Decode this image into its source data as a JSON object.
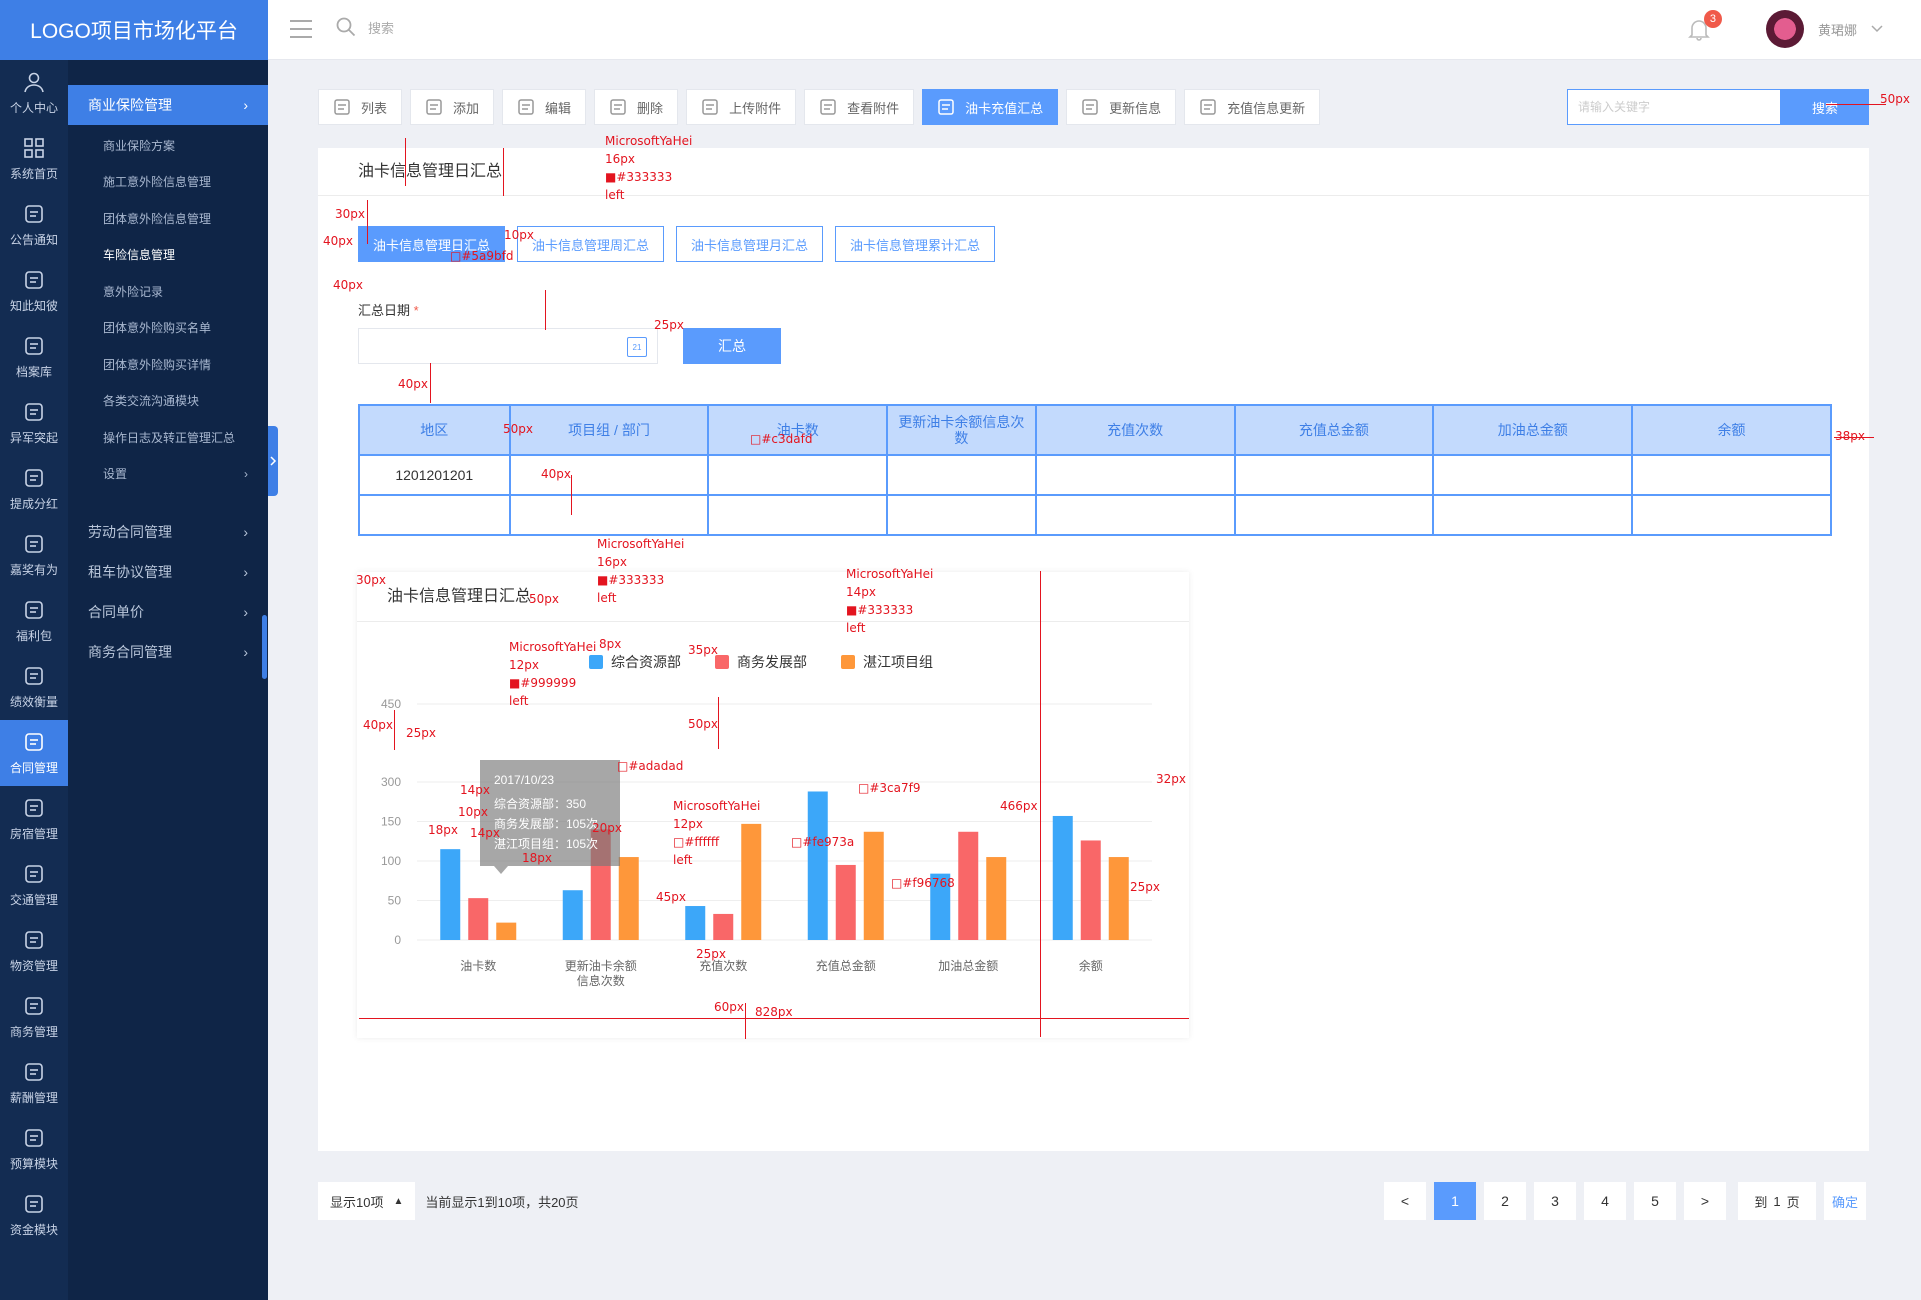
{
  "app": {
    "title": "LOGO项目市场化平台"
  },
  "topbar": {
    "search_placeholder": "搜索",
    "notification_count": "3",
    "username": "黄珺娜"
  },
  "rail": [
    {
      "label": "个人中心",
      "icon": "user-icon"
    },
    {
      "label": "系统首页",
      "icon": "grid-icon"
    },
    {
      "label": "公告通知",
      "icon": "bell-icon"
    },
    {
      "label": "知此知彼",
      "icon": "graduation-cap-icon"
    },
    {
      "label": "档案库",
      "icon": "monitor-chart-icon"
    },
    {
      "label": "异军突起",
      "icon": "megaphone-icon"
    },
    {
      "label": "提成分红",
      "icon": "dollar-icon"
    },
    {
      "label": "嘉奖有为",
      "icon": "trophy-icon"
    },
    {
      "label": "福利包",
      "icon": "gift-icon"
    },
    {
      "label": "绩效衡量",
      "icon": "user-search-icon"
    },
    {
      "label": "合同管理",
      "icon": "contract-icon",
      "active": true
    },
    {
      "label": "房宿管理",
      "icon": "house-icon"
    },
    {
      "label": "交通管理",
      "icon": "bus-icon"
    },
    {
      "label": "物资管理",
      "icon": "lotus-icon"
    },
    {
      "label": "商务管理",
      "icon": "briefcase-icon"
    },
    {
      "label": "薪酬管理",
      "icon": "wallet-icon"
    },
    {
      "label": "预算模块",
      "icon": "sliders-icon"
    },
    {
      "label": "资金模块",
      "icon": "coins-icon"
    }
  ],
  "sidebar": {
    "section": "商业保险管理",
    "items": [
      "商业保险方案",
      "施工意外险信息管理",
      "团体意外险信息管理",
      "车险信息管理",
      "意外险记录",
      "团体意外险购买名单",
      "团体意外险购买详情",
      "各类交流沟通模块",
      "操作日志及转正管理汇总",
      "设置"
    ],
    "active_index": 3,
    "groups": [
      "劳动合同管理",
      "租车协议管理",
      "合同单价",
      "商务合同管理"
    ]
  },
  "toolbar": {
    "buttons": [
      {
        "label": "列表",
        "icon": "list-icon"
      },
      {
        "label": "添加",
        "icon": "plus-circle-icon"
      },
      {
        "label": "编辑",
        "icon": "edit-icon"
      },
      {
        "label": "删除",
        "icon": "trash-icon"
      },
      {
        "label": "上传附件",
        "icon": "paperclip-icon"
      },
      {
        "label": "查看附件",
        "icon": "magnifier-icon"
      },
      {
        "label": "油卡充值汇总",
        "icon": "clipboard-icon",
        "active": true
      },
      {
        "label": "更新信息",
        "icon": "chat-icon"
      },
      {
        "label": "充值信息更新",
        "icon": "chat-dots-icon"
      }
    ],
    "keyword_placeholder": "请输入关键字",
    "search_label": "搜索"
  },
  "panel": {
    "title": "油卡信息管理日汇总",
    "tabs": [
      "油卡信息管理日汇总",
      "油卡信息管理周汇总",
      "油卡信息管理月汇总",
      "油卡信息管理累计汇总"
    ],
    "active_tab": 0,
    "date_label": "汇总日期",
    "required_mark": "*",
    "date_icon_text": "21",
    "submit_label": "汇总"
  },
  "table": {
    "headers": [
      "地区",
      "项目组 / 部门",
      "油卡数",
      "更新油卡余额信息次数",
      "充值次数",
      "充值总金额",
      "加油总金额",
      "余额"
    ],
    "rows": [
      [
        "1201201201",
        "",
        "",
        "",
        "",
        "",
        "",
        ""
      ],
      [
        "",
        "",
        "",
        "",
        "",
        "",
        "",
        ""
      ]
    ]
  },
  "chart_card": {
    "title": "油卡信息管理日汇总"
  },
  "chart_data": {
    "type": "bar",
    "categories": [
      "油卡数",
      "更新油卡余额\n信息次数",
      "充值次数",
      "充值总金额",
      "加油总金额",
      "余额"
    ],
    "series": [
      {
        "name": "综合资源部",
        "color": "#3ca7f9",
        "values": [
          115,
          63,
          43,
          188,
          84,
          157
        ]
      },
      {
        "name": "商务发展部",
        "color": "#f96768",
        "values": [
          53,
          140,
          33,
          95,
          137,
          126
        ]
      },
      {
        "name": "湛江项目组",
        "color": "#fe973a",
        "values": [
          22,
          105,
          147,
          137,
          105,
          105
        ]
      }
    ],
    "y_ticks": [
      0,
      50,
      100,
      150,
      200,
      450
    ],
    "y_tick_labels": [
      "0",
      "50",
      "100",
      "150",
      "300",
      "450"
    ],
    "ylim": [
      0,
      250
    ],
    "grid": true,
    "legend": "top-center",
    "tooltip": {
      "date": "2017/10/23",
      "lines": [
        "综合资源部：350",
        "商务发展部：105次",
        "湛江项目组：105次"
      ]
    }
  },
  "annotations": [
    {
      "id": "a1",
      "text": "MicrosoftYaHei\n16px\n■#333333\nleft"
    },
    {
      "id": "a2",
      "text": "30px"
    },
    {
      "id": "a3",
      "text": "40px"
    },
    {
      "id": "a4",
      "text": "10px"
    },
    {
      "id": "a5",
      "text": "□#5a9bfd"
    },
    {
      "id": "a6",
      "text": "40px"
    },
    {
      "id": "a7",
      "text": "25px"
    },
    {
      "id": "a8",
      "text": "40px"
    },
    {
      "id": "a9",
      "text": "50px"
    },
    {
      "id": "a10",
      "text": "□#c3dafd"
    },
    {
      "id": "a11",
      "text": "40px"
    },
    {
      "id": "a12",
      "text": "38px"
    },
    {
      "id": "a13",
      "text": "50px"
    },
    {
      "id": "a14",
      "text": "MicrosoftYaHei\n16px\n■#333333\nleft"
    },
    {
      "id": "a15",
      "text": "30px"
    },
    {
      "id": "a16",
      "text": "50px"
    },
    {
      "id": "a17",
      "text": "MicrosoftYaHei\n14px\n■#333333\nleft"
    },
    {
      "id": "a18",
      "text": "MicrosoftYaHei\n12px\n■#999999\nleft"
    },
    {
      "id": "a19",
      "text": "8px"
    },
    {
      "id": "a20",
      "text": "35px"
    },
    {
      "id": "a21",
      "text": "40px"
    },
    {
      "id": "a22",
      "text": "25px"
    },
    {
      "id": "a23",
      "text": "50px"
    },
    {
      "id": "a24",
      "text": "□#adadad"
    },
    {
      "id": "a25",
      "text": "□#3ca7f9"
    },
    {
      "id": "a26",
      "text": "32px"
    },
    {
      "id": "a27",
      "text": "466px"
    },
    {
      "id": "a28",
      "text": "14px"
    },
    {
      "id": "a29",
      "text": "10px"
    },
    {
      "id": "a30",
      "text": "14px"
    },
    {
      "id": "a31",
      "text": "18px"
    },
    {
      "id": "a32",
      "text": "20px"
    },
    {
      "id": "a33",
      "text": "18px"
    },
    {
      "id": "a34",
      "text": "MicrosoftYaHei\n12px\n□#ffffff\nleft"
    },
    {
      "id": "a35",
      "text": "□#fe973a"
    },
    {
      "id": "a36",
      "text": "□#f96768"
    },
    {
      "id": "a37",
      "text": "45px"
    },
    {
      "id": "a38",
      "text": "25px"
    },
    {
      "id": "a39",
      "text": "25px"
    },
    {
      "id": "a40",
      "text": "60px"
    },
    {
      "id": "a41",
      "text": "828px"
    }
  ],
  "footer": {
    "per_page": "显示10项",
    "summary": "当前显示1到10项，共20页",
    "prev": "<",
    "next": ">",
    "pages": [
      "1",
      "2",
      "3",
      "4",
      "5"
    ],
    "active_page": "1",
    "goto_prefix": "到",
    "goto_value": "1",
    "goto_suffix": "页",
    "confirm": "确定"
  }
}
